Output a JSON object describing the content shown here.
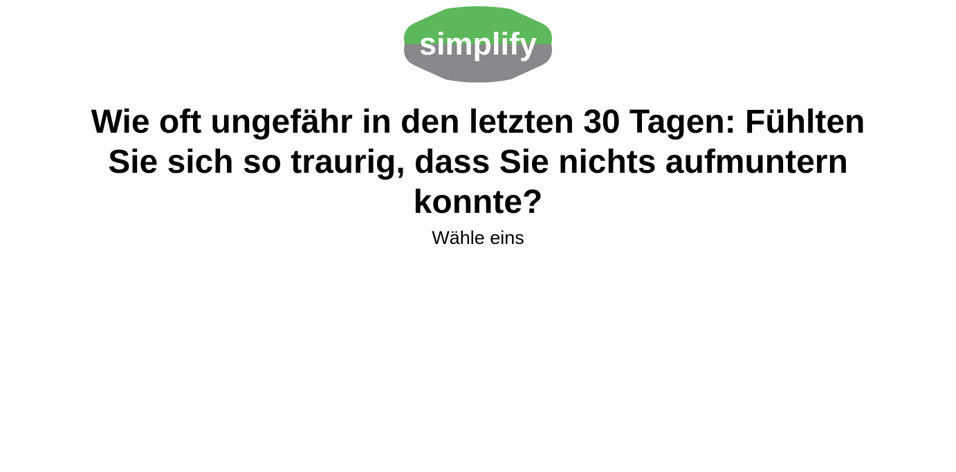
{
  "logo": {
    "text": "simplify",
    "top_color": "#5cb85a",
    "bottom_color": "#87888c",
    "text_color": "#ffffff"
  },
  "question": {
    "text": "Wie oft ungefähr in den letzten 30 Tagen: Fühlten Sie sich so traurig, dass Sie nichts aufmuntern konnte?"
  },
  "instruction": {
    "text": "Wähle eins"
  }
}
